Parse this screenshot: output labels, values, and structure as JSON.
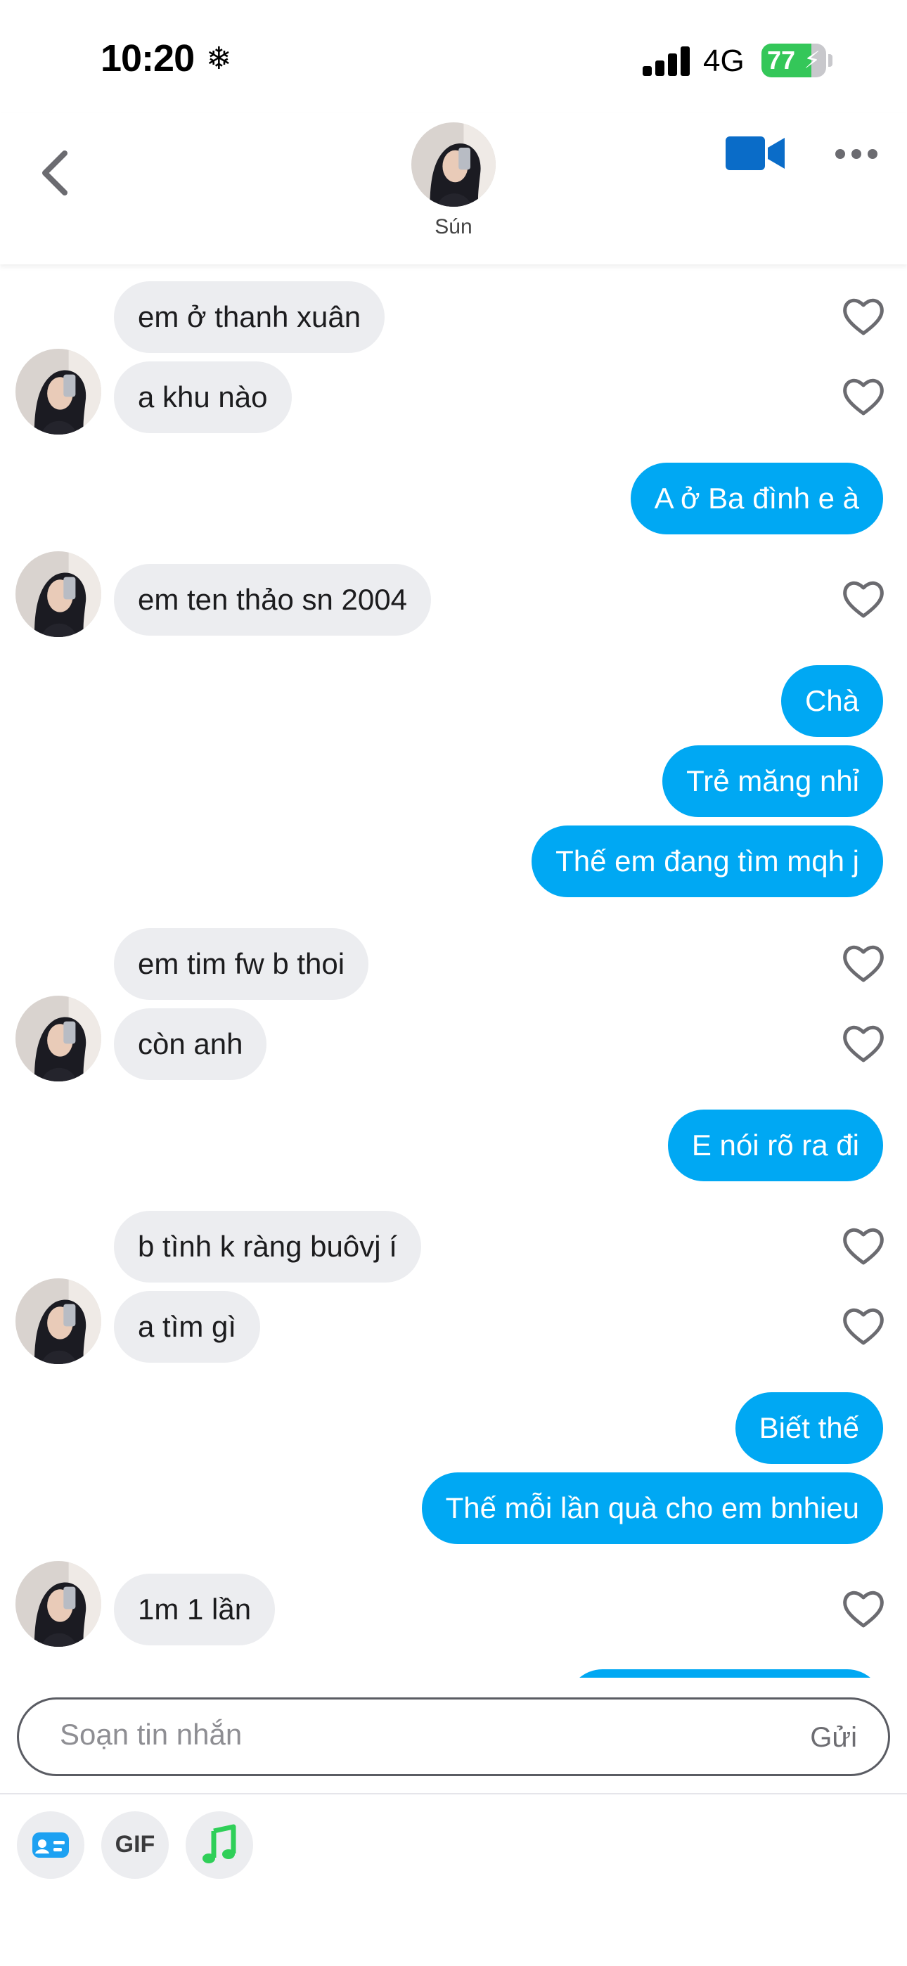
{
  "status_bar": {
    "time": "10:20",
    "network": "4G",
    "battery": "77",
    "battery_level": 0.77,
    "icons": [
      "snowflake-icon",
      "signal-icon",
      "battery-icon",
      "charging-bolt-icon"
    ]
  },
  "header": {
    "contact_name": "Sún",
    "icons": [
      "back-chevron-icon",
      "video-call-icon",
      "more-dots-icon"
    ],
    "accent": "#0a6cc8"
  },
  "messages": [
    {
      "from": "them",
      "text": "em ở thanh xuân",
      "liked": false
    },
    {
      "from": "them",
      "text": " a khu nào",
      "liked": false
    },
    {
      "from": "me",
      "text": "A ở Ba đình e à"
    },
    {
      "from": "them",
      "text": "em ten thảo sn 2004",
      "liked": false
    },
    {
      "from": "me",
      "text": "Chà"
    },
    {
      "from": "me",
      "text": "Trẻ măng nhỉ"
    },
    {
      "from": "me",
      "text": "Thế em đang tìm mqh j"
    },
    {
      "from": "them",
      "text": "em tim fw b thoi",
      "liked": false
    },
    {
      "from": "them",
      "text": " còn anh",
      "liked": false
    },
    {
      "from": "me",
      "text": "E nói rõ ra đi"
    },
    {
      "from": "them",
      "text": "b tình k ràng buôvj í",
      "liked": false
    },
    {
      "from": "them",
      "text": " a tìm gì",
      "liked": false
    },
    {
      "from": "me",
      "text": "Biết thế"
    },
    {
      "from": "me",
      "text": "Thế mỗi lần quà cho em bnhieu"
    },
    {
      "from": "them",
      "text": "1m 1 lần",
      "liked": false
    }
  ],
  "composer": {
    "placeholder": "Soạn tin nhắn",
    "send_label": "Gửi",
    "tools": [
      {
        "name": "sticker-card-icon",
        "color": "#1da1f2"
      },
      {
        "name": "gif",
        "label": "GIF"
      },
      {
        "name": "music-note-icon",
        "color": "#2fcf58"
      }
    ]
  },
  "colors": {
    "outgoing_bubble": "#00a8f3",
    "incoming_bubble": "#ecedf0"
  }
}
